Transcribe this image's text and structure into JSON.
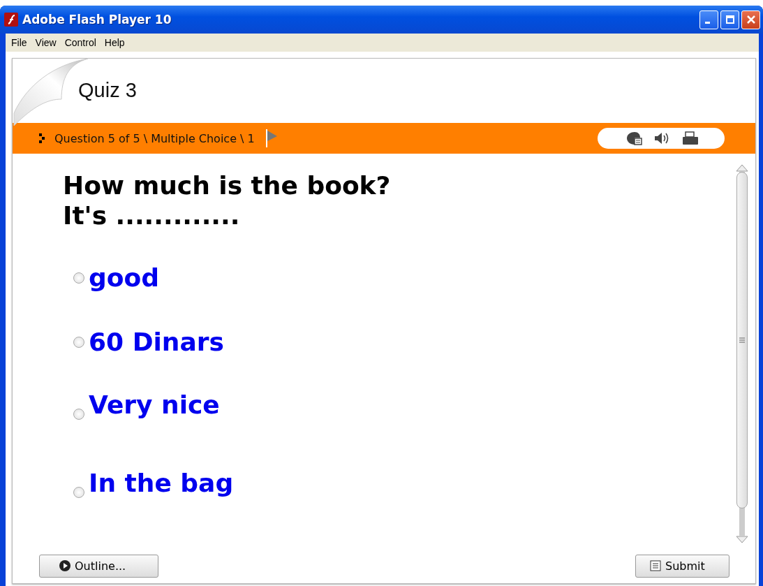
{
  "window": {
    "title": "Adobe Flash Player 10"
  },
  "menu": [
    "File",
    "View",
    "Control",
    "Help"
  ],
  "quiz": {
    "title": "Quiz 3",
    "breadcrumb": "Question 5 of 5 \\ Multiple Choice \\ 1",
    "question_lines": [
      "How much is the book?",
      "It's ............."
    ],
    "options": [
      {
        "label": "good",
        "selected": false
      },
      {
        "label": "60 Dinars",
        "selected": false
      },
      {
        "label": "Very nice",
        "selected": false
      },
      {
        "label": "In the bag",
        "selected": false
      }
    ],
    "buttons": {
      "outline": "Outline...",
      "submit": "Submit"
    }
  }
}
